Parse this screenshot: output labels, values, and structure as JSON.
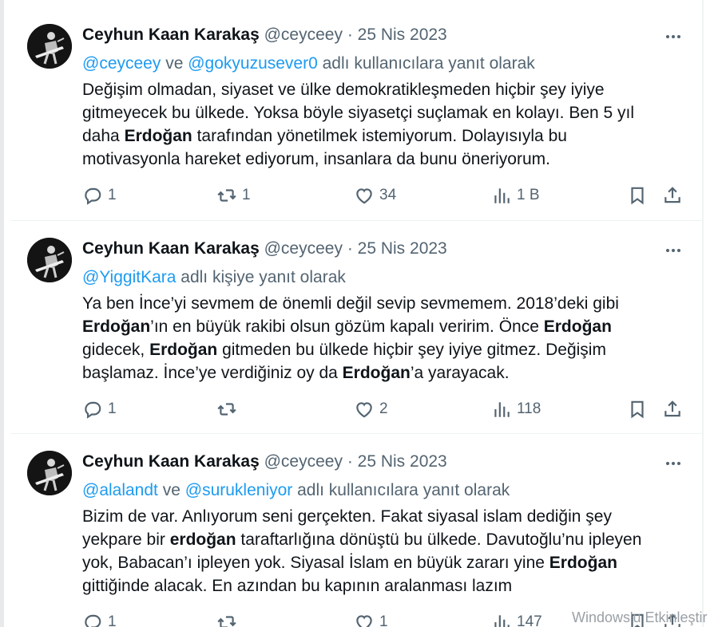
{
  "tweets": [
    {
      "name": "Ceyhun Kaan Karakaş",
      "handle": "@ceyceey",
      "separator": "·",
      "date": "25 Nis 2023",
      "reply_mentions": [
        "@ceyceey",
        "@gokyuzusever0"
      ],
      "reply_joiner": " ve ",
      "reply_suffix": " adlı kullanıcılara yanıt olarak",
      "body_lines": [
        [
          {
            "t": "Değişim olmadan, siyaset ve ülke demokratikleşmeden hiçbir şey iyiye"
          }
        ],
        [
          {
            "t": "gitmeyecek bu ülkede. Yoksa böyle siyasetçi suçlamak en kolayı. Ben 5 yıl"
          }
        ],
        [
          {
            "t": "daha "
          },
          {
            "t": "Erdoğan",
            "b": true
          },
          {
            "t": " tarafından yönetilmek istemiyorum. Dolayısıyla bu"
          }
        ],
        [
          {
            "t": "motivasyonla hareket ediyorum, insanlara da bunu öneriyorum."
          }
        ]
      ],
      "replies": "1",
      "retweets": "1",
      "likes": "34",
      "views": "1 B"
    },
    {
      "name": "Ceyhun Kaan Karakaş",
      "handle": "@ceyceey",
      "separator": "·",
      "date": "25 Nis 2023",
      "reply_mentions": [
        "@YiggitKara"
      ],
      "reply_joiner": "",
      "reply_suffix": " adlı kişiye yanıt olarak",
      "body_lines": [
        [
          {
            "t": "Ya ben İnce’yi sevmem de önemli değil sevip sevmemem. 2018’deki gibi"
          }
        ],
        [
          {
            "t": "Erdoğan",
            "b": true
          },
          {
            "t": "’ın en büyük rakibi olsun gözüm kapalı veririm. Önce "
          },
          {
            "t": "Erdoğan",
            "b": true
          }
        ],
        [
          {
            "t": "gidecek, "
          },
          {
            "t": "Erdoğan",
            "b": true
          },
          {
            "t": " gitmeden bu ülkede hiçbir şey iyiye gitmez. Değişim"
          }
        ],
        [
          {
            "t": "başlamaz. İnce’ye verdiğiniz oy da "
          },
          {
            "t": "Erdoğan",
            "b": true
          },
          {
            "t": "’a yarayacak."
          }
        ]
      ],
      "replies": "1",
      "retweets": "",
      "likes": "2",
      "views": "118"
    },
    {
      "name": "Ceyhun Kaan Karakaş",
      "handle": "@ceyceey",
      "separator": "·",
      "date": "25 Nis 2023",
      "reply_mentions": [
        "@alalandt",
        "@surukleniyor"
      ],
      "reply_joiner": " ve ",
      "reply_suffix": " adlı kullanıcılara yanıt olarak",
      "body_lines": [
        [
          {
            "t": "Bizim de var. Anlıyorum seni gerçekten. Fakat siyasal islam dediğin şey"
          }
        ],
        [
          {
            "t": "yekpare bir "
          },
          {
            "t": "erdoğan",
            "b": true
          },
          {
            "t": " taraftarlığına dönüştü bu ülkede. Davutoğlu’nu ipleyen"
          }
        ],
        [
          {
            "t": "yok, Babacan’ı ipleyen yok. Siyasal İslam en büyük zararı yine "
          },
          {
            "t": "Erdoğan",
            "b": true
          }
        ],
        [
          {
            "t": "gittiğinde alacak. En azından bu kapının aralanması lazım"
          }
        ]
      ],
      "replies": "1",
      "retweets": "",
      "likes": "1",
      "views": "147"
    }
  ],
  "watermark": "Windows'u Etkinleştir",
  "icons": {
    "reply": "reply-icon",
    "retweet": "retweet-icon",
    "like": "heart-icon",
    "views": "views-icon",
    "bookmark": "bookmark-icon",
    "share": "share-icon",
    "more": "more-icon"
  },
  "colors": {
    "text": "#0f1419",
    "secondary": "#536471",
    "link": "#1d9bf0"
  }
}
